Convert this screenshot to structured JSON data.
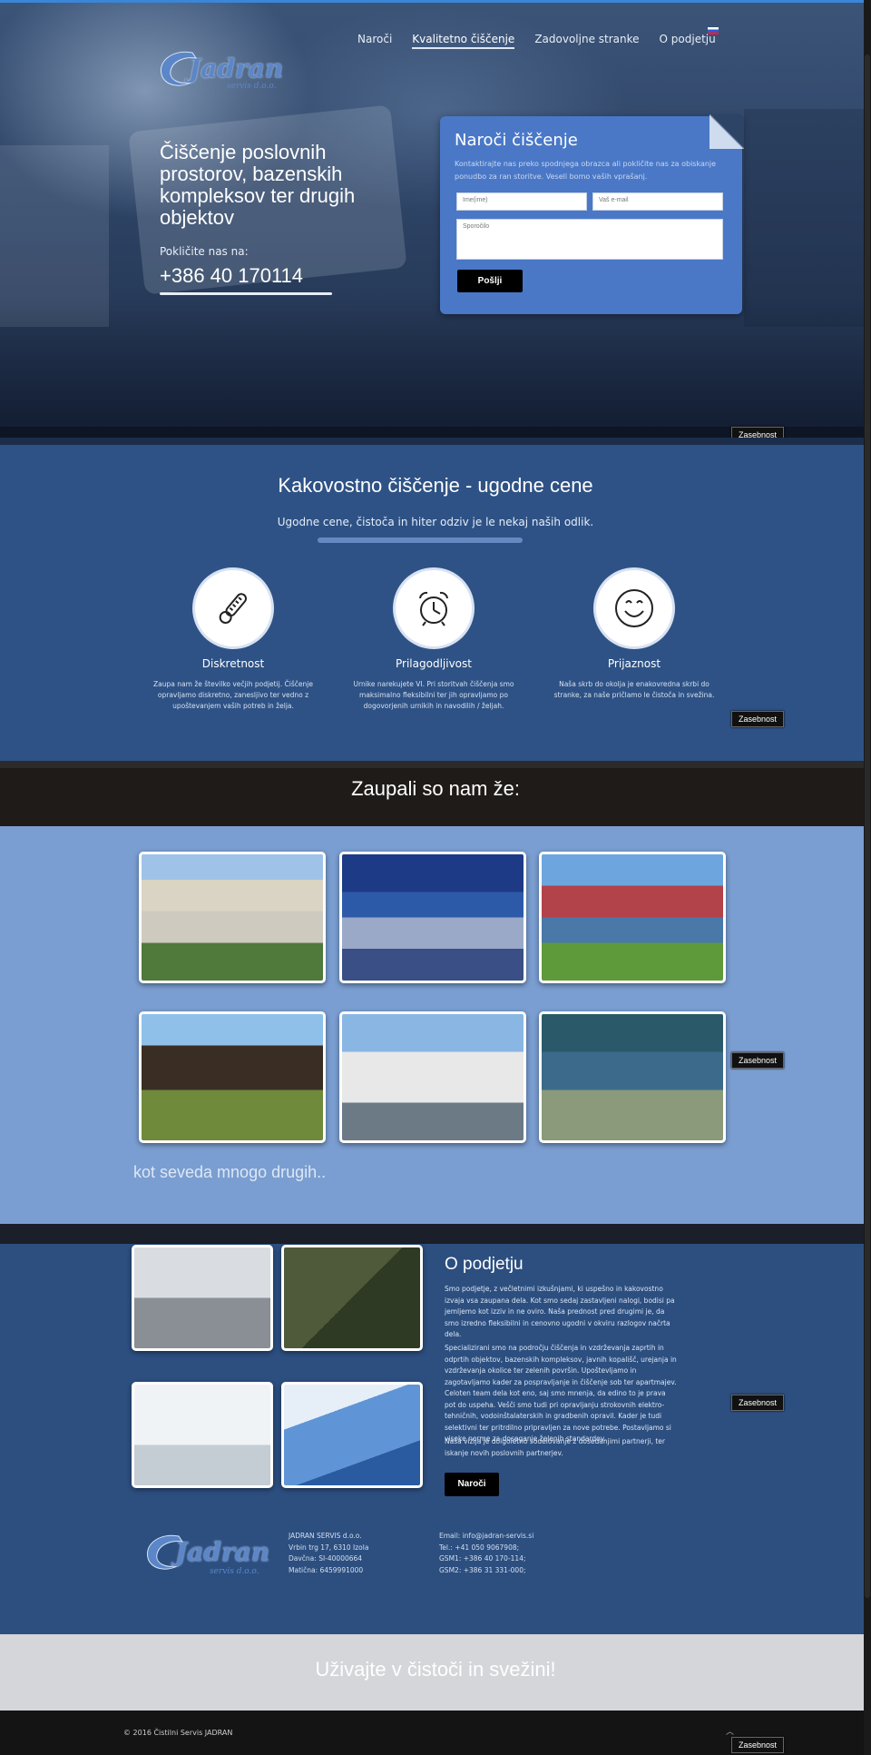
{
  "brand": {
    "name": "Jadran",
    "sub": "servis d.o.o."
  },
  "nav": {
    "items": [
      "Naroči",
      "Kvalitetno čiščenje",
      "Zadovoljne stranke",
      "O podjetju"
    ],
    "active_index": 1,
    "language": "ru-flag-icon"
  },
  "hero": {
    "title": "Čiščenje poslovnih prostorov, bazenskih kompleksov ter drugih objektov",
    "call_label": "Pokličite nas na:",
    "phone": "+386 40 170114"
  },
  "order_form": {
    "title": "Naroči čiščenje",
    "description": "Kontaktirajte nas preko spodnjega obrazca ali pokličite nas za obiskanje ponudbo za ran storitve. Veseli bomo vaših vprašanj.",
    "name_placeholder": "Ime(ime)",
    "email_placeholder": "Vaš e-mail",
    "message_placeholder": "Sporočilo",
    "submit_label": "Pošlji"
  },
  "privacy_label": "Zasebnost",
  "features": {
    "title": "Kakovostno čiščenje - ugodne cene",
    "subtitle": "Ugodne cene, čistoča in hiter odziv je le nekaj naših odlik.",
    "items": [
      {
        "icon": "thermometer-icon",
        "title": "Diskretnost",
        "text": "Zaupa nam že številko večjih podjetij. Čiščenje opravljamo diskretno, zanesljivo ter vedno z upoštevanjem vaših potreb in želja."
      },
      {
        "icon": "alarm-clock-icon",
        "title": "Prilagodljivost",
        "text": "Urnike narekujete VI. Pri storitvah čiščenja smo maksimalno fleksibilni ter jih opravljamo po dogovorjenih urnikih in navodilih / željah."
      },
      {
        "icon": "smiley-icon",
        "title": "Prijaznost",
        "text": "Naša skrb do okolja je enakovredna skrbi do stranke, za naše pričlamo le čistoča in svežina."
      }
    ]
  },
  "clients": {
    "title": "Zaupali so nam že:",
    "more": "kot seveda mnogo drugih.."
  },
  "about": {
    "title": "O podjetju",
    "paragraphs": [
      "Smo podjetje, z večletnimi izkušnjami, ki uspešno in kakovostno izvaja vsa zaupana dela. Kot smo sedaj zastavljeni nalogi, bodisi pa jemljemo kot izziv in ne oviro. Naša prednost pred drugimi je, da smo izredno fleksibilni in cenovno ugodni v okviru razlogov načrta dela.",
      "Specializirani smo na področju čiščenja in vzdrževanja zaprtih in odprtih objektov, bazenskih kompleksov, javnih kopališč, urejanja in vzdrževanja okolice ter zelenih površin. Upoštevljamo in zagotavljamo kader za pospravljanje in čiščenje sob ter apartmajev. Celoten team dela kot eno, saj smo mnenja, da edino to je prava pot do uspeha. Vešči smo tudi pri opravljanju strokovnih elektro-tehničnih, vodoinštalaterskih in gradbenih opravil. Kader je tudi selektivni ter pritrdilno pripravljen za nove potrebe. Postavljamo si visoke norme za doseganje želenih standardov.",
      "Naša vizija je dolgoletno sodelovanje z dosedanjimi partnerji, ter iskanje novih poslovnih partnerjev."
    ],
    "button_label": "Naroči"
  },
  "company": {
    "name": "JADRAN SERVIS d.o.o.",
    "address": "Vrbin trg 17, 6310 Izola",
    "tax": "Davčna: SI-40000664",
    "reg": "Matična: 6459991000",
    "email": "Email: info@jadran-servis.si",
    "phone1": "Tel.: +41 050 9067908;",
    "phone2": "GSM1: +386 40 170-114;",
    "phone3": "GSM2: +386 31 331-000;"
  },
  "slogan": "Uživajte v čistoči in svežini!",
  "footer": {
    "copyright": "© 2016 Čistilni Servis JADRAN"
  },
  "colors": {
    "accent": "#4a78c7",
    "features_bg": "#2e5285",
    "clients_bg": "#7a9ed1",
    "about_bg": "#2c4f80"
  }
}
